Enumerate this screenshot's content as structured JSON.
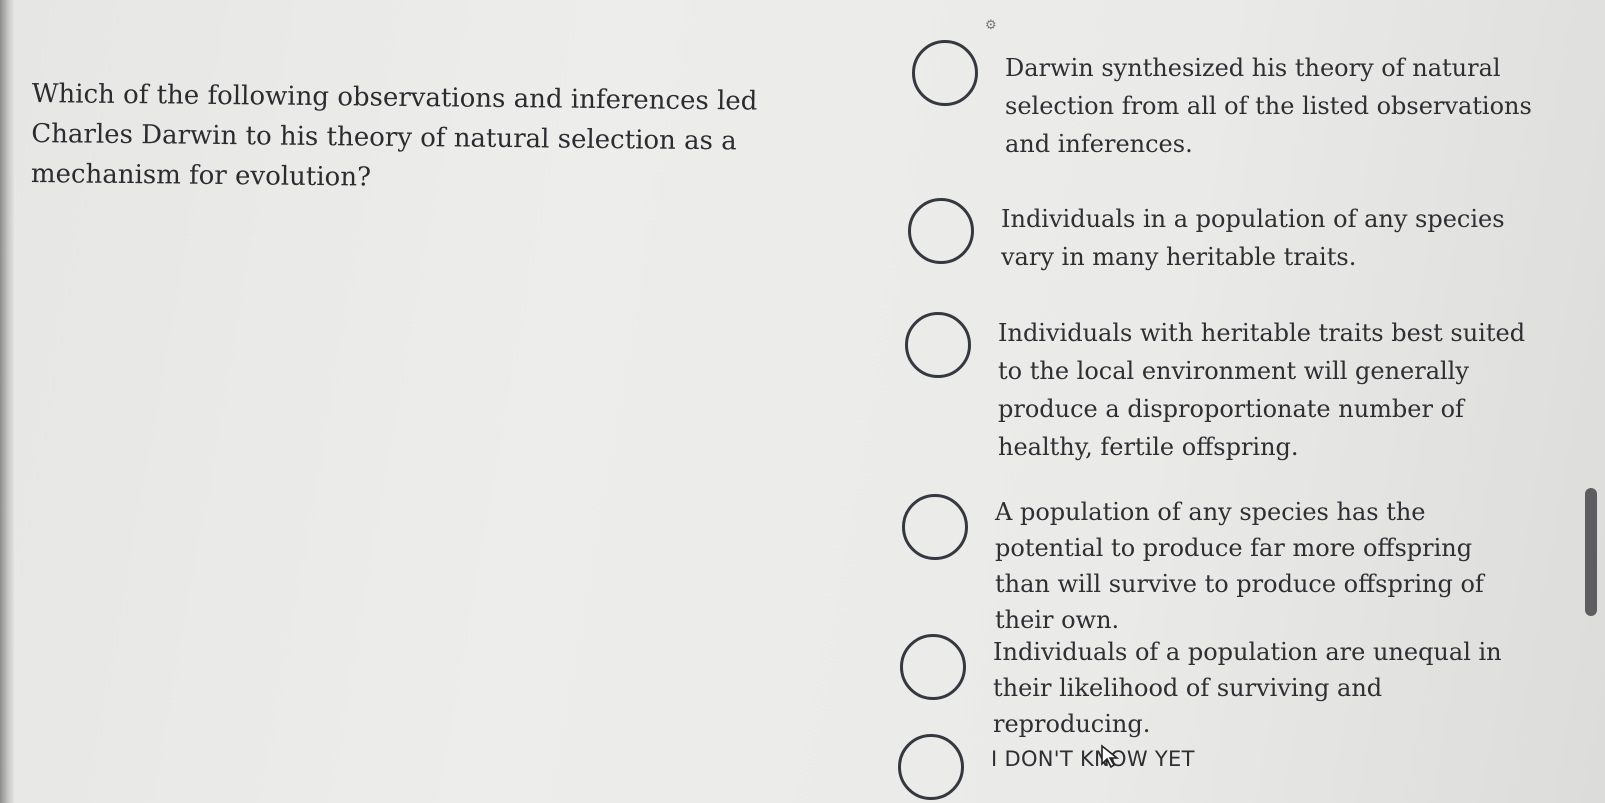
{
  "question": {
    "text": "Which of the following observations and inferences led Charles Darwin to his theory of natural selection as a mechanism for evolution?"
  },
  "options": [
    {
      "label": "Darwin synthesized his theory of natural selection from all of the listed observations and inferences.",
      "selected": false
    },
    {
      "label": "Individuals in a population of any species vary in many heritable traits.",
      "selected": false
    },
    {
      "label": "Individuals with heritable traits best suited to the local environment will generally produce a disproportionate number of healthy, fertile offspring.",
      "selected": false
    },
    {
      "label": "A population of any species has the potential to produce far more offspring than will survive to produce offspring of their own.",
      "selected": false
    },
    {
      "label": "Individuals of a population are unequal in their likelihood of surviving and reproducing.",
      "selected": false
    },
    {
      "label": "I DON'T KNOW YET",
      "selected": false
    }
  ],
  "icons": {
    "radio": "radio-button-icon",
    "cursor": "mouse-pointer-icon"
  },
  "colors": {
    "background": "#ebebe9",
    "text": "#2e2e33",
    "radio_border": "#34383f",
    "scrollbar": "#5e5e60"
  }
}
